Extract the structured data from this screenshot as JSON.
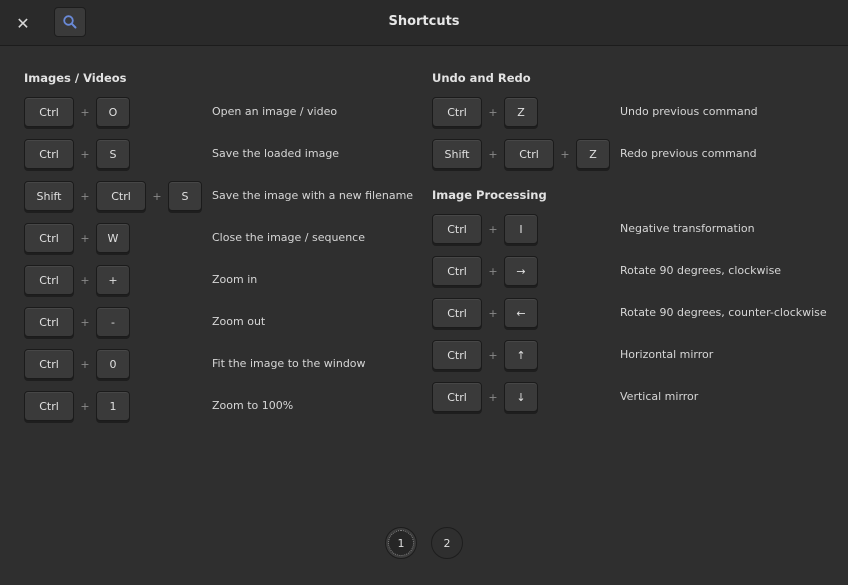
{
  "header": {
    "title": "Shortcuts",
    "close_icon": "✕",
    "search_icon": "search-icon"
  },
  "sections": {
    "images": {
      "title": "Images / Videos",
      "rows": [
        {
          "keys": [
            "Ctrl",
            "O"
          ],
          "desc": "Open an image / video"
        },
        {
          "keys": [
            "Ctrl",
            "S"
          ],
          "desc": "Save the loaded image"
        },
        {
          "keys": [
            "Shift",
            "Ctrl",
            "S"
          ],
          "desc": "Save the image with a new filename"
        },
        {
          "keys": [
            "Ctrl",
            "W"
          ],
          "desc": "Close the image / sequence"
        },
        {
          "keys": [
            "Ctrl",
            "+"
          ],
          "desc": "Zoom in"
        },
        {
          "keys": [
            "Ctrl",
            "-"
          ],
          "desc": "Zoom out"
        },
        {
          "keys": [
            "Ctrl",
            "0"
          ],
          "desc": "Fit the image to the window"
        },
        {
          "keys": [
            "Ctrl",
            "1"
          ],
          "desc": "Zoom to 100%"
        }
      ]
    },
    "undo": {
      "title": "Undo and Redo",
      "rows": [
        {
          "keys": [
            "Ctrl",
            "Z"
          ],
          "desc": "Undo previous command"
        },
        {
          "keys": [
            "Shift",
            "Ctrl",
            "Z"
          ],
          "desc": "Redo previous command"
        }
      ]
    },
    "processing": {
      "title": "Image Processing",
      "rows": [
        {
          "keys": [
            "Ctrl",
            "I"
          ],
          "desc": "Negative transformation"
        },
        {
          "keys": [
            "Ctrl",
            "→"
          ],
          "desc": "Rotate 90 degrees, clockwise"
        },
        {
          "keys": [
            "Ctrl",
            "←"
          ],
          "desc": "Rotate 90 degrees, counter-clockwise"
        },
        {
          "keys": [
            "Ctrl",
            "↑"
          ],
          "desc": "Horizontal mirror"
        },
        {
          "keys": [
            "Ctrl",
            "↓"
          ],
          "desc": "Vertical mirror"
        }
      ]
    }
  },
  "pager": {
    "pages": [
      "1",
      "2"
    ],
    "active": "1"
  },
  "colors": {
    "background": "#2f2f2f",
    "header": "#2a2a2a",
    "key": "#3a3a3a",
    "search_accent": "#6a8ad8"
  }
}
